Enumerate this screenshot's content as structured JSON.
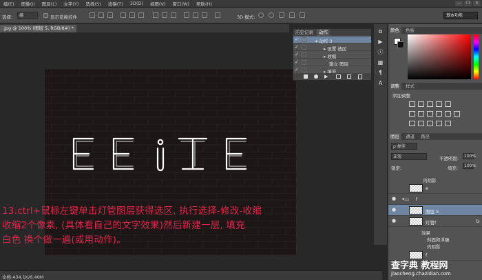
{
  "menubar": {
    "items": [
      "编(E)",
      "图像(I)",
      "图层(L)",
      "文字(Y)",
      "选择(S)",
      "滤镜(T)",
      "3D(D)",
      "视图(V)",
      "窗口(W)",
      "帮助(H)"
    ],
    "win_min": "—",
    "win_max": "❐",
    "win_close": "✕"
  },
  "optbar": {
    "select_label": "选择:",
    "select_value": "组",
    "show_transform": "显示变换控件",
    "mode_3d": "3D 模式:",
    "workspace": "基本功能"
  },
  "document": {
    "tab_title": ".jpg @ 100% (图层 5, RGB/8#) *",
    "status": "文档:434.1K/6.40M"
  },
  "canvas_text": "EEITE",
  "note": {
    "line1": "13.ctrl+鼠标左键单击灯管图层获得选区, 执行选择-修改-收缩",
    "line2": "收缩2个像素, (具体看自己的文字效果)然后新建一层, 填充",
    "line3": "白色 换个做一遍(或用动作)。"
  },
  "actions_panel": {
    "tab_history": "历史记录",
    "tab_actions": "动作",
    "rows": [
      {
        "check": "✓",
        "label": "▾ 动作 3",
        "selected": true
      },
      {
        "check": "✓",
        "label": "▸ 设置 选区",
        "selected": false
      },
      {
        "check": "✓",
        "label": "▸ 收缩",
        "selected": false
      },
      {
        "check": "✓",
        "label": "建立 图层",
        "selected": false
      },
      {
        "check": "✓",
        "label": "▸ 填充",
        "selected": false
      }
    ]
  },
  "color_panel": {
    "tab_color": "颜色",
    "tab_swatches": "色板"
  },
  "adjust_panel": {
    "tab_adjust": "调整",
    "tab_styles": "样式",
    "title": "添加调整"
  },
  "layers_panel": {
    "tab_layers": "图层",
    "tab_channels": "通道",
    "tab_paths": "路径",
    "filter": "ρ 类型",
    "blend_mode": "正常",
    "opacity_label": "不透明度:",
    "opacity_value": "100%",
    "lock_label": "锁定:",
    "fill_label": "填充:",
    "fill_value": "100%",
    "inner_shadow_top": "内阴影",
    "layers": [
      {
        "name": "e",
        "selected": false,
        "eye": "",
        "fx": ""
      },
      {
        "name": "f",
        "selected": false,
        "eye": "●",
        "fx": ""
      },
      {
        "name": "图层 5",
        "selected": true,
        "eye": "●",
        "fx": ""
      },
      {
        "name": "灯管f",
        "selected": false,
        "eye": "●",
        "fx": "fx"
      }
    ],
    "effects_label": "效果",
    "bevel_label": "斜面和浮雕",
    "inner_shadow": "内阴影",
    "last_layer": "f"
  },
  "watermark": {
    "title": "查字典 教程网",
    "url": "jiaocheng.chazidian.com"
  }
}
